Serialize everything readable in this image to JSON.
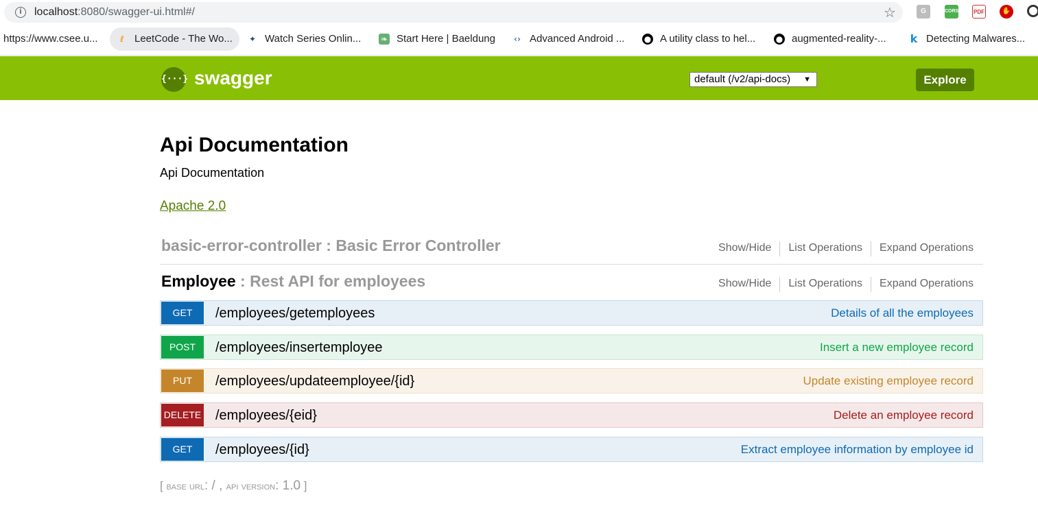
{
  "browser": {
    "url_host": "localhost",
    "url_rest": ":8080/swagger-ui.html#/",
    "extensions": [
      "G",
      "CORS",
      "PDF",
      "block",
      "edge"
    ],
    "bookmarks": [
      {
        "label": "https://www.csee.u...",
        "icon": ""
      },
      {
        "label": "LeetCode - The Wo...",
        "icon": "leetcode-icon"
      },
      {
        "label": "Watch Series Onlin...",
        "icon": "series-icon"
      },
      {
        "label": "Start Here | Baeldung",
        "icon": "baeldung-icon"
      },
      {
        "label": "Advanced Android ...",
        "icon": "code-icon"
      },
      {
        "label": "A utility class to hel...",
        "icon": "github-icon"
      },
      {
        "label": "augmented-reality-...",
        "icon": "github-icon"
      },
      {
        "label": "Detecting Malwares...",
        "icon": "k-icon"
      }
    ]
  },
  "header": {
    "logo_text": "swagger",
    "logo_glyph": "{···}",
    "spec_select": "default (/v2/api-docs)",
    "explore_label": "Explore",
    "colors": {
      "bar": "#89bf04",
      "button": "#547f00"
    }
  },
  "info": {
    "title": "Api Documentation",
    "description": "Api Documentation",
    "license": "Apache 2.0"
  },
  "resources": [
    {
      "name": "basic-error-controller",
      "description": " : Basic Error Controller",
      "links": [
        "Show/Hide",
        "List Operations",
        "Expand Operations"
      ]
    },
    {
      "name": "Employee",
      "description": " : Rest API for employees",
      "links": [
        "Show/Hide",
        "List Operations",
        "Expand Operations"
      ]
    }
  ],
  "operations": [
    {
      "method": "GET",
      "path": "/employees/getemployees",
      "summary": "Details of all the employees"
    },
    {
      "method": "POST",
      "path": "/employees/insertemployee",
      "summary": "Insert a new employee record"
    },
    {
      "method": "PUT",
      "path": "/employees/updateemployee/{id}",
      "summary": "Update existing employee record"
    },
    {
      "method": "DELETE",
      "path": "/employees/{eid}",
      "summary": "Delete an employee record"
    },
    {
      "method": "GET",
      "path": "/employees/{id}",
      "summary": "Extract employee information by employee id"
    }
  ],
  "footer": {
    "open": "[ ",
    "base_url_label": "base url",
    "base_url": ": / , ",
    "api_version_label": "api version",
    "api_version": ": 1.0",
    "close": " ]"
  }
}
